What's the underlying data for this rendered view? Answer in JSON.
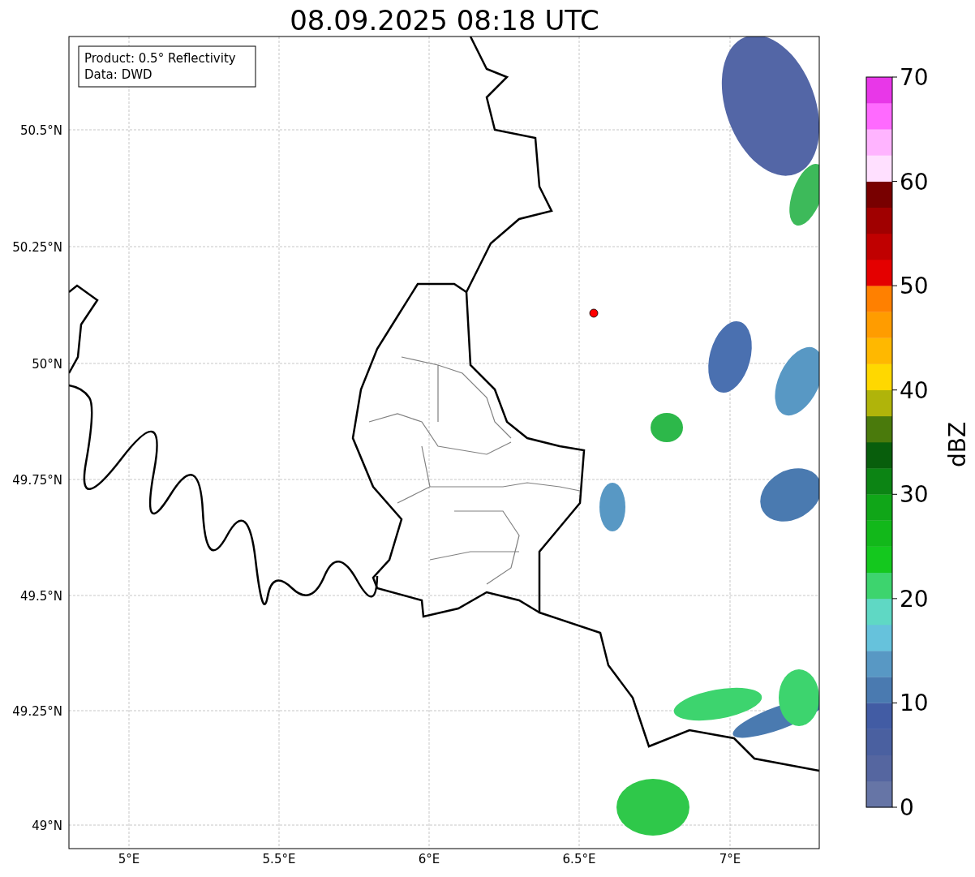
{
  "title": "08.09.2025 08:18 UTC",
  "info_box": [
    "Product: 0.5° Reflectivity",
    "Data: DWD"
  ],
  "y_ticks": [
    "50.5°N",
    "50.25°N",
    "50°N",
    "49.75°N",
    "49.5°N",
    "49.25°N",
    "49°N"
  ],
  "x_ticks": [
    "5°E",
    "5.5°E",
    "6°E",
    "6.5°E",
    "7°E"
  ],
  "colorbar": {
    "label": "dBZ",
    "ticks": [
      "70",
      "60",
      "50",
      "40",
      "30",
      "20",
      "10",
      "0"
    ],
    "segments": [
      {
        "color": "#6675a6"
      },
      {
        "color": "#5566a0"
      },
      {
        "color": "#4a60a0"
      },
      {
        "color": "#425ca4"
      },
      {
        "color": "#4a7ab0"
      },
      {
        "color": "#5898c4"
      },
      {
        "color": "#66c2dc"
      },
      {
        "color": "#5fd8c4"
      },
      {
        "color": "#3dd46e"
      },
      {
        "color": "#14c81e"
      },
      {
        "color": "#12b81a"
      },
      {
        "color": "#10a618"
      },
      {
        "color": "#0c8414"
      },
      {
        "color": "#085e0c"
      },
      {
        "color": "#4a7a0c"
      },
      {
        "color": "#b0b40a"
      },
      {
        "color": "#ffd800"
      },
      {
        "color": "#ffb800"
      },
      {
        "color": "#ff9c00"
      },
      {
        "color": "#ff8000"
      },
      {
        "color": "#e40000"
      },
      {
        "color": "#c00000"
      },
      {
        "color": "#a00000"
      },
      {
        "color": "#780000"
      },
      {
        "color": "#ffe0ff"
      },
      {
        "color": "#ffb4ff"
      },
      {
        "color": "#ff6aff"
      },
      {
        "color": "#e837e8"
      }
    ]
  }
}
